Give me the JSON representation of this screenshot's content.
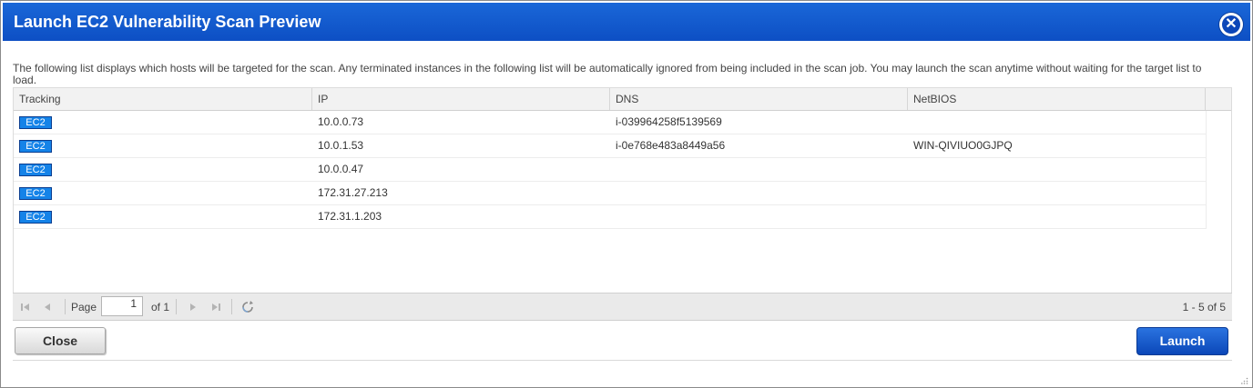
{
  "dialog": {
    "title": "Launch EC2 Vulnerability Scan Preview",
    "close_icon": "close-icon",
    "description": "The following list displays which hosts will be targeted for the scan. Any terminated instances in the following list will be automatically ignored from being included in the scan job. You may launch the scan anytime without waiting for the target list to load."
  },
  "grid": {
    "columns": [
      "Tracking",
      "IP",
      "DNS",
      "NetBIOS"
    ],
    "rows": [
      {
        "tracking": "EC2",
        "ip": "10.0.0.73",
        "dns": "i-039964258f5139569",
        "netbios": ""
      },
      {
        "tracking": "EC2",
        "ip": "10.0.1.53",
        "dns": "i-0e768e483a8449a56",
        "netbios": "WIN-QIVIUO0GJPQ"
      },
      {
        "tracking": "EC2",
        "ip": "10.0.0.47",
        "dns": "",
        "netbios": ""
      },
      {
        "tracking": "EC2",
        "ip": "172.31.27.213",
        "dns": "",
        "netbios": ""
      },
      {
        "tracking": "EC2",
        "ip": "172.31.1.203",
        "dns": "",
        "netbios": ""
      }
    ]
  },
  "pager": {
    "page_label": "Page",
    "page_value": "1",
    "of_label": "of 1",
    "count": "1 - 5 of 5"
  },
  "buttons": {
    "close": "Close",
    "launch": "Launch"
  }
}
